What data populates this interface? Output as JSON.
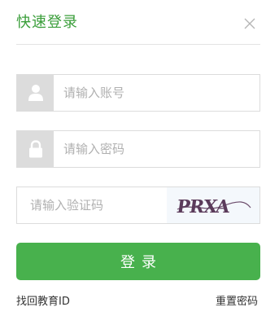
{
  "dialog": {
    "title": "快速登录"
  },
  "fields": {
    "username_placeholder": "请输入账号",
    "password_placeholder": "请输入密码",
    "captcha_placeholder": "请输入验证码"
  },
  "captcha": {
    "text": "PRXA"
  },
  "actions": {
    "login_label": "登录",
    "find_id_label": "找回教育ID",
    "reset_password_label": "重置密码"
  },
  "colors": {
    "brand_green": "#48b14d",
    "title_green": "#3a9e3a",
    "icon_bg": "#dcdcdc"
  }
}
